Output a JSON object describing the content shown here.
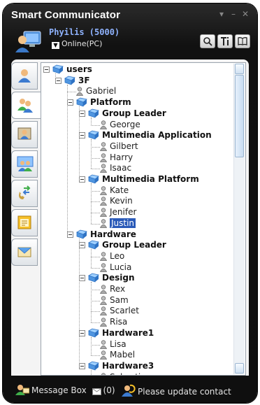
{
  "app": {
    "title": "Smart Communicator"
  },
  "window_controls": [
    "▾",
    "–",
    "✕"
  ],
  "user": {
    "name": "Phyilis (5000)",
    "status": "Online(PC)"
  },
  "toolbar": {
    "icons": [
      "search-icon",
      "tools-icon",
      "book-icon"
    ]
  },
  "sidebar": {
    "tabs": [
      "users-tab",
      "contacts-tab",
      "group-tab",
      "conference-tab",
      "transfer-tab",
      "calendar-tab",
      "message-tab"
    ]
  },
  "tree": {
    "nodes": [
      {
        "label": "users",
        "type": "root"
      },
      {
        "label": "3F",
        "type": "group"
      },
      {
        "label": "Gabriel",
        "type": "user"
      },
      {
        "label": "Platform",
        "type": "group"
      },
      {
        "label": "Group Leader",
        "type": "group"
      },
      {
        "label": "George",
        "type": "user"
      },
      {
        "label": "Multimedia Application",
        "type": "group"
      },
      {
        "label": "Gilbert",
        "type": "user"
      },
      {
        "label": "Harry",
        "type": "user"
      },
      {
        "label": "Isaac",
        "type": "user"
      },
      {
        "label": "Multimedia Platform",
        "type": "group"
      },
      {
        "label": "Kate",
        "type": "user"
      },
      {
        "label": "Kevin",
        "type": "user"
      },
      {
        "label": "Jenifer",
        "type": "user"
      },
      {
        "label": "Justin",
        "type": "user",
        "selected": true
      },
      {
        "label": "Hardware",
        "type": "group"
      },
      {
        "label": "Group Leader",
        "type": "group"
      },
      {
        "label": "Leo",
        "type": "user"
      },
      {
        "label": "Lucia",
        "type": "user"
      },
      {
        "label": "Design",
        "type": "group"
      },
      {
        "label": "Rex",
        "type": "user"
      },
      {
        "label": "Sam",
        "type": "user"
      },
      {
        "label": "Scarlet",
        "type": "user"
      },
      {
        "label": "Risa",
        "type": "user"
      },
      {
        "label": "Hardware1",
        "type": "group"
      },
      {
        "label": "Lisa",
        "type": "user"
      },
      {
        "label": "Mabel",
        "type": "user"
      },
      {
        "label": "Hardware3",
        "type": "group"
      },
      {
        "label": "Sebastian",
        "type": "user"
      }
    ]
  },
  "footer": {
    "message_box": "Message Box",
    "message_count": "(0)",
    "update_notice": "Please update contact"
  },
  "colors": {
    "selection": "#2a5ab8",
    "username": "#8fb3ff",
    "window": "#111111"
  }
}
